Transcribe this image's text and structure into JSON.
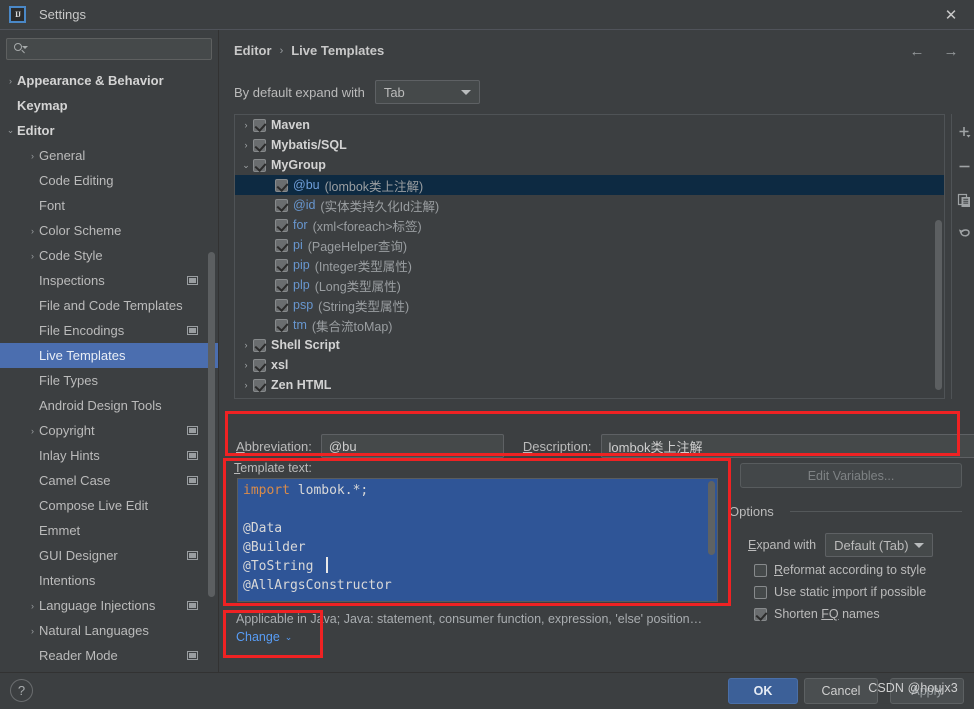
{
  "window": {
    "title": "Settings",
    "logo_text": "IJ",
    "close_icon": "✕"
  },
  "search": {
    "value": "",
    "placeholder": "",
    "icon": "search-icon"
  },
  "sidebar": {
    "items": [
      {
        "label": "Appearance & Behavior",
        "level": 0,
        "twisty": "›",
        "badge": false,
        "selected": false
      },
      {
        "label": "Keymap",
        "level": 0,
        "twisty": "",
        "badge": false,
        "selected": false
      },
      {
        "label": "Editor",
        "level": 0,
        "twisty": "⌄",
        "badge": false,
        "selected": false
      },
      {
        "label": "General",
        "level": 1,
        "twisty": "›",
        "badge": false,
        "selected": false
      },
      {
        "label": "Code Editing",
        "level": 1,
        "twisty": "",
        "badge": false,
        "selected": false
      },
      {
        "label": "Font",
        "level": 1,
        "twisty": "",
        "badge": false,
        "selected": false
      },
      {
        "label": "Color Scheme",
        "level": 1,
        "twisty": "›",
        "badge": false,
        "selected": false
      },
      {
        "label": "Code Style",
        "level": 1,
        "twisty": "›",
        "badge": false,
        "selected": false
      },
      {
        "label": "Inspections",
        "level": 1,
        "twisty": "",
        "badge": true,
        "selected": false
      },
      {
        "label": "File and Code Templates",
        "level": 1,
        "twisty": "",
        "badge": false,
        "selected": false
      },
      {
        "label": "File Encodings",
        "level": 1,
        "twisty": "",
        "badge": true,
        "selected": false
      },
      {
        "label": "Live Templates",
        "level": 1,
        "twisty": "",
        "badge": false,
        "selected": true
      },
      {
        "label": "File Types",
        "level": 1,
        "twisty": "",
        "badge": false,
        "selected": false
      },
      {
        "label": "Android Design Tools",
        "level": 1,
        "twisty": "",
        "badge": false,
        "selected": false
      },
      {
        "label": "Copyright",
        "level": 1,
        "twisty": "›",
        "badge": true,
        "selected": false
      },
      {
        "label": "Inlay Hints",
        "level": 1,
        "twisty": "",
        "badge": true,
        "selected": false
      },
      {
        "label": "Camel Case",
        "level": 1,
        "twisty": "",
        "badge": true,
        "selected": false
      },
      {
        "label": "Compose Live Edit",
        "level": 1,
        "twisty": "",
        "badge": false,
        "selected": false
      },
      {
        "label": "Emmet",
        "level": 1,
        "twisty": "",
        "badge": false,
        "selected": false
      },
      {
        "label": "GUI Designer",
        "level": 1,
        "twisty": "",
        "badge": true,
        "selected": false
      },
      {
        "label": "Intentions",
        "level": 1,
        "twisty": "",
        "badge": false,
        "selected": false
      },
      {
        "label": "Language Injections",
        "level": 1,
        "twisty": "›",
        "badge": true,
        "selected": false
      },
      {
        "label": "Natural Languages",
        "level": 1,
        "twisty": "›",
        "badge": false,
        "selected": false
      },
      {
        "label": "Reader Mode",
        "level": 1,
        "twisty": "",
        "badge": true,
        "selected": false
      }
    ]
  },
  "main": {
    "breadcrumb": {
      "parent": "Editor",
      "separator": "›",
      "current": "Live Templates"
    },
    "nav": {
      "back_icon": "←",
      "forward_icon": "→"
    },
    "expand_default": {
      "label": "By default expand with",
      "value": "Tab"
    },
    "template_list": [
      {
        "type": "group",
        "twisty": "›",
        "checked": true,
        "name": "Maven",
        "desc": ""
      },
      {
        "type": "group",
        "twisty": "›",
        "checked": true,
        "name": "Mybatis/SQL",
        "desc": ""
      },
      {
        "type": "group",
        "twisty": "⌄",
        "checked": true,
        "name": "MyGroup",
        "desc": ""
      },
      {
        "type": "template",
        "twisty": "",
        "checked": true,
        "name": "@bu",
        "desc": "(lombok类上注解)",
        "selected": true
      },
      {
        "type": "template",
        "twisty": "",
        "checked": true,
        "name": "@id",
        "desc": "(实体类持久化Id注解)"
      },
      {
        "type": "template",
        "twisty": "",
        "checked": true,
        "name": "for",
        "desc": "(xml<foreach>标签)"
      },
      {
        "type": "template",
        "twisty": "",
        "checked": true,
        "name": "pi",
        "desc": "(PageHelper查询)"
      },
      {
        "type": "template",
        "twisty": "",
        "checked": true,
        "name": "pip",
        "desc": "(Integer类型属性)"
      },
      {
        "type": "template",
        "twisty": "",
        "checked": true,
        "name": "plp",
        "desc": "(Long类型属性)"
      },
      {
        "type": "template",
        "twisty": "",
        "checked": true,
        "name": "psp",
        "desc": "(String类型属性)"
      },
      {
        "type": "template",
        "twisty": "",
        "checked": true,
        "name": "tm",
        "desc": "(集合流toMap)"
      },
      {
        "type": "group",
        "twisty": "›",
        "checked": true,
        "name": "Shell Script",
        "desc": ""
      },
      {
        "type": "group",
        "twisty": "›",
        "checked": true,
        "name": "xsl",
        "desc": ""
      },
      {
        "type": "group",
        "twisty": "›",
        "checked": true,
        "name": "Zen HTML",
        "desc": ""
      }
    ],
    "list_toolbar": [
      {
        "name": "add-template-button",
        "icon": "plus-icon"
      },
      {
        "name": "remove-template-button",
        "icon": "minus-icon"
      },
      {
        "name": "duplicate-template-button",
        "icon": "copy-icon"
      },
      {
        "name": "restore-defaults-button",
        "icon": "undo-icon"
      }
    ],
    "abbreviation": {
      "label_pre": "A",
      "label_mnemonic": "A",
      "label": "Abbreviation:",
      "value": "@bu"
    },
    "description": {
      "label": "Description:",
      "value": "lombok类上注解"
    },
    "template_text": {
      "label": "Template text:",
      "lines": [
        {
          "keyword": "import",
          "rest": " lombok.*;"
        },
        {
          "keyword": "",
          "rest": ""
        },
        {
          "keyword": "",
          "rest": "@Data"
        },
        {
          "keyword": "",
          "rest": "@Builder"
        },
        {
          "keyword": "",
          "rest": "@ToString"
        },
        {
          "keyword": "",
          "rest": "@AllArgsConstructor"
        }
      ]
    },
    "applicable": {
      "text": "Applicable in Java; Java: statement, consumer function, expression, 'else' position…",
      "change_label": "Change",
      "change_caret": "⌄"
    },
    "edit_variables_label": "Edit Variables...",
    "options": {
      "title": "Options",
      "expand_with": {
        "label": "Expand with",
        "value": "Default (Tab)"
      },
      "checkboxes": [
        {
          "label": "Reformat according to style",
          "mnemonic": "R",
          "checked": false
        },
        {
          "label": "Use static import if possible",
          "mnemonic": "i",
          "checked": false
        },
        {
          "label": "Shorten FQ names",
          "mnemonic": "FQ",
          "checked": true
        }
      ]
    }
  },
  "footer": {
    "help_label": "?",
    "ok_label": "OK",
    "cancel_label": "Cancel",
    "apply_label": "Apply",
    "watermark": "CSDN @houjx3"
  },
  "colors": {
    "window_bg": "#3c3f41",
    "selection_blue": "#4b6eaf",
    "list_selection": "#0d2a42",
    "accent_link": "#589df6",
    "annotation_red": "#ef2223",
    "code_keyword": "#d98b4a",
    "code_selection": "#2f5597",
    "ok_button": "#3c6098"
  }
}
